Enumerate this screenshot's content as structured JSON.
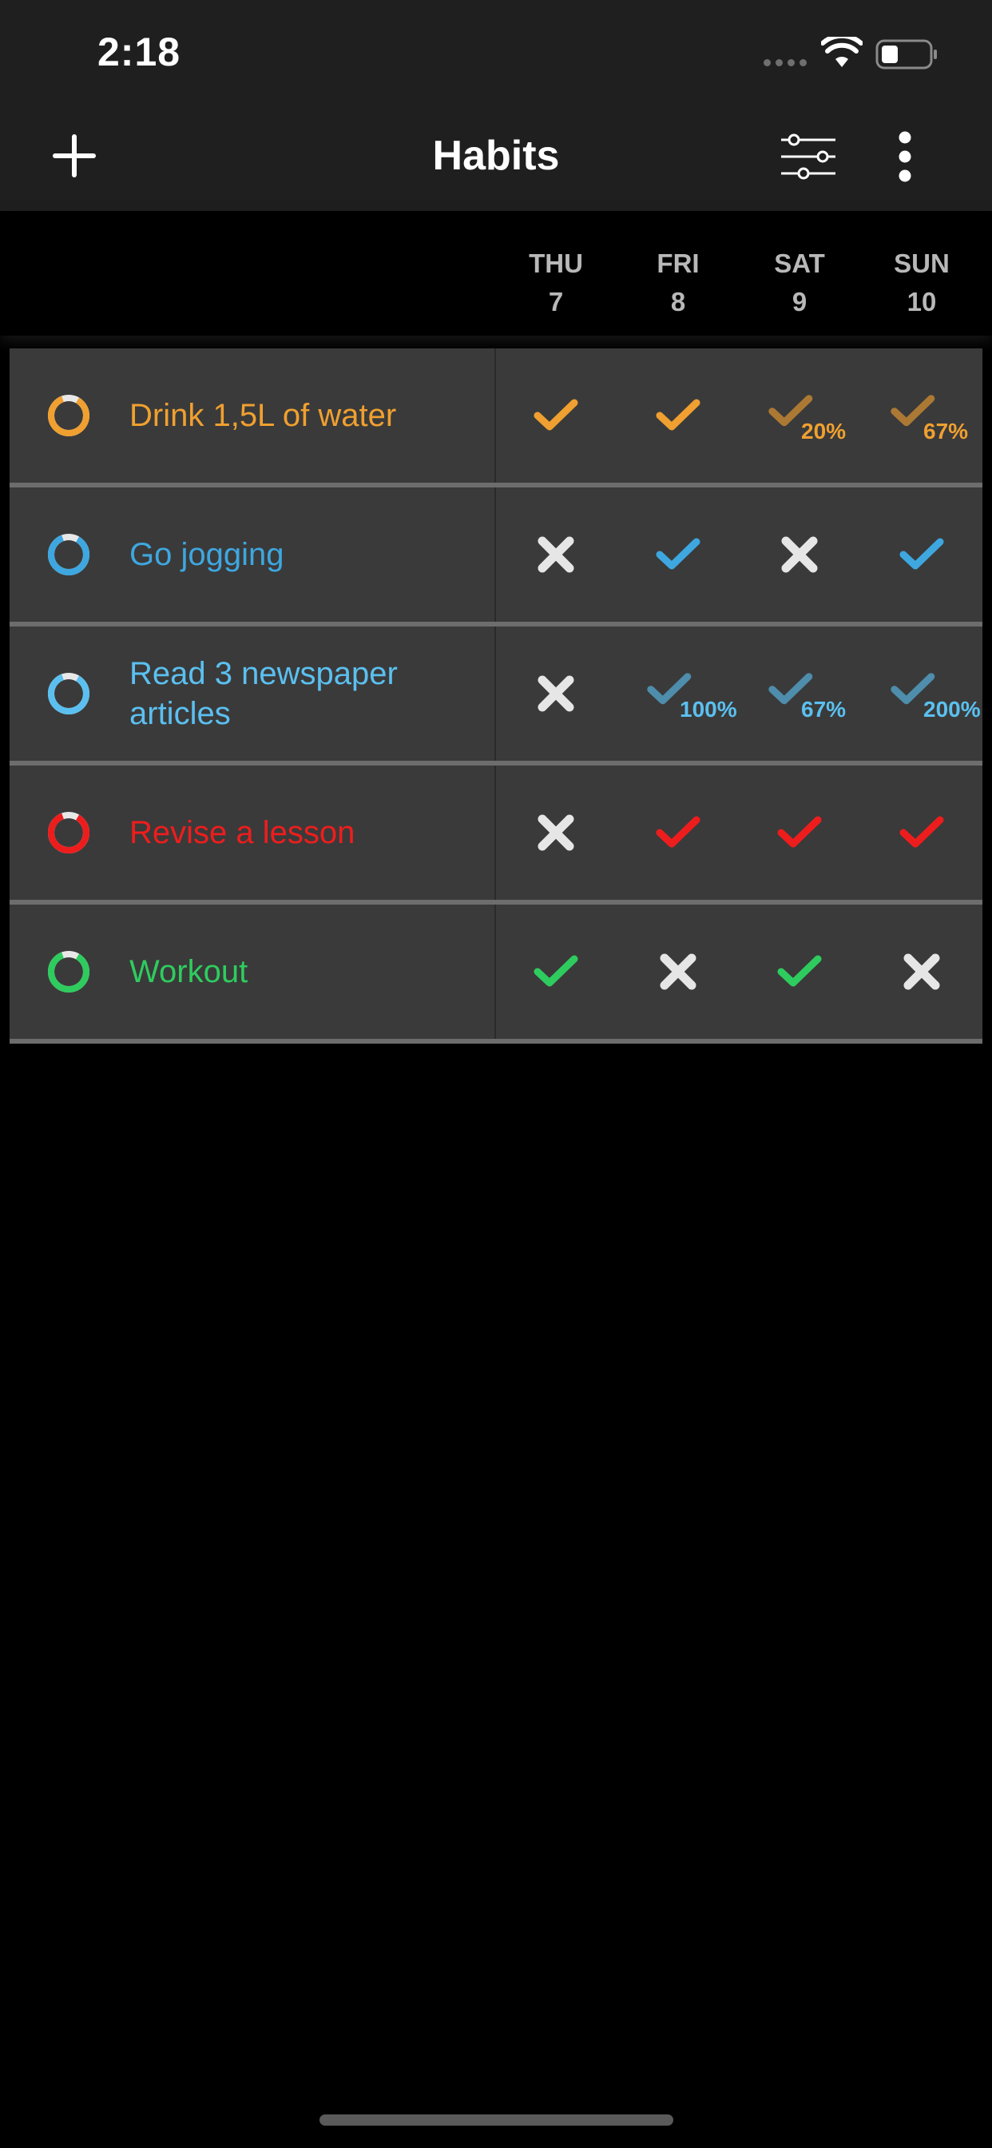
{
  "status_bar": {
    "time": "2:18"
  },
  "nav": {
    "title": "Habits",
    "add_icon": "plus-icon",
    "filter_icon": "sliders-icon",
    "more_icon": "more-vertical-icon"
  },
  "days": [
    {
      "dow": "THU",
      "date": "7"
    },
    {
      "dow": "FRI",
      "date": "8"
    },
    {
      "dow": "SAT",
      "date": "9"
    },
    {
      "dow": "SUN",
      "date": "10"
    }
  ],
  "colors": {
    "orange": "#f0a030",
    "blue": "#3ea7e0",
    "light_blue": "#5bc0f0",
    "red": "#ee1d1d",
    "green": "#2ecc5e",
    "cross": "#e6e6e6"
  },
  "habits": [
    {
      "name": "Drink 1,5L of water",
      "color": "#f0a030",
      "entries": [
        {
          "mark": "check",
          "percent": ""
        },
        {
          "mark": "check",
          "percent": ""
        },
        {
          "mark": "check-partial",
          "percent": "20%"
        },
        {
          "mark": "check-partial",
          "percent": "67%"
        }
      ]
    },
    {
      "name": "Go jogging",
      "color": "#3ea7e0",
      "entries": [
        {
          "mark": "cross",
          "percent": ""
        },
        {
          "mark": "check",
          "percent": ""
        },
        {
          "mark": "cross",
          "percent": ""
        },
        {
          "mark": "check",
          "percent": ""
        }
      ]
    },
    {
      "name": "Read 3 newspaper articles",
      "color": "#5bc0f0",
      "entries": [
        {
          "mark": "cross",
          "percent": ""
        },
        {
          "mark": "check-partial",
          "percent": "100%"
        },
        {
          "mark": "check-partial",
          "percent": "67%"
        },
        {
          "mark": "check-partial",
          "percent": "200%"
        }
      ]
    },
    {
      "name": "Revise a lesson",
      "color": "#ee1d1d",
      "entries": [
        {
          "mark": "cross",
          "percent": ""
        },
        {
          "mark": "check",
          "percent": ""
        },
        {
          "mark": "check",
          "percent": ""
        },
        {
          "mark": "check",
          "percent": ""
        }
      ]
    },
    {
      "name": "Workout",
      "color": "#2ecc5e",
      "entries": [
        {
          "mark": "check",
          "percent": ""
        },
        {
          "mark": "cross",
          "percent": ""
        },
        {
          "mark": "check",
          "percent": ""
        },
        {
          "mark": "cross",
          "percent": ""
        }
      ]
    }
  ]
}
